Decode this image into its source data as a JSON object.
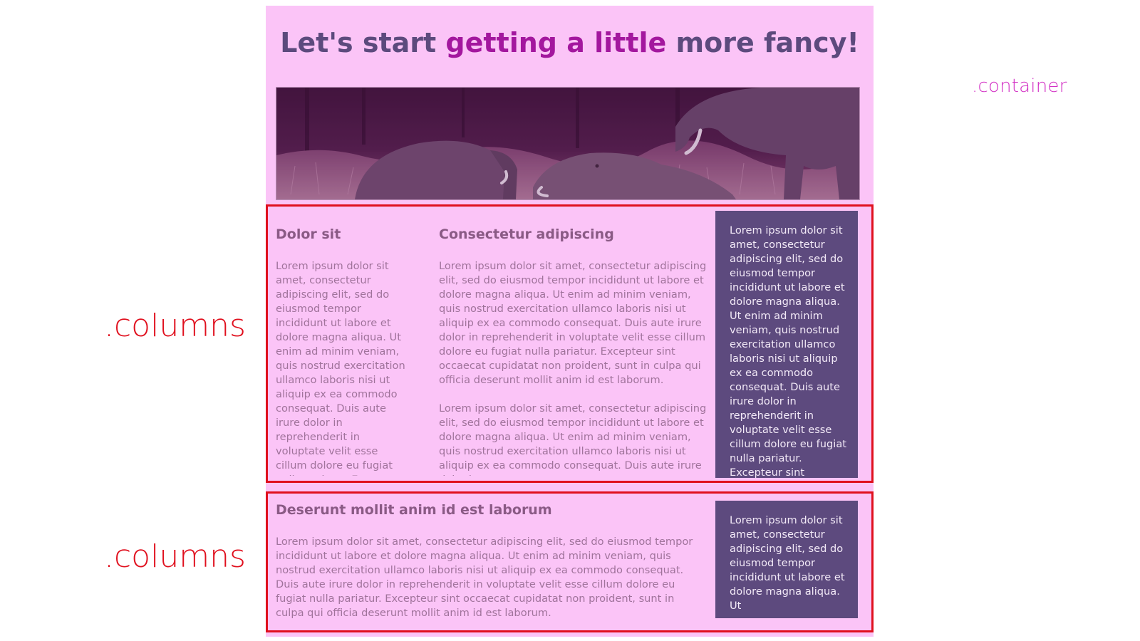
{
  "annotations": {
    "container": ".container",
    "columns_1": ".columns",
    "columns_2": ".columns"
  },
  "header": {
    "title_part1": "Let's start ",
    "title_accent": "getting a little",
    "title_part2": " more fancy!"
  },
  "hero_image": {
    "icon": "elephants-photo",
    "tint": "#6b2a63"
  },
  "row1": {
    "col1": {
      "heading": "Dolor sit",
      "text": "Lorem ipsum dolor sit amet, consectetur adipiscing elit, sed do eiusmod tempor incididunt ut labore et dolore magna aliqua. Ut enim ad minim veniam, quis nostrud exercitation ullamco laboris nisi ut aliquip ex ea commodo consequat. Duis aute irure dolor in reprehenderit in voluptate velit esse cillum dolore eu fugiat nulla pariatur. Excepteur sint occaecat"
    },
    "col2": {
      "heading": "Consectetur adipiscing",
      "para1": "Lorem ipsum dolor sit amet, consectetur adipiscing elit, sed do eiusmod tempor incididunt ut labore et dolore magna aliqua. Ut enim ad minim veniam, quis nostrud exercitation ullamco laboris nisi ut aliquip ex ea commodo consequat. Duis aute irure dolor in reprehenderit in voluptate velit esse cillum dolore eu fugiat nulla pariatur. Excepteur sint occaecat cupidatat non proident, sunt in culpa qui officia deserunt mollit anim id est laborum.",
      "para2": "Lorem ipsum dolor sit amet, consectetur adipiscing elit, sed do eiusmod tempor incididunt ut labore et dolore magna aliqua. Ut enim ad minim veniam, quis nostrud exercitation ullamco laboris nisi ut aliquip ex ea commodo consequat. Duis aute irure dolor in"
    },
    "aside": {
      "text": "Lorem ipsum dolor sit amet, consectetur adipiscing elit, sed do eiusmod tempor incididunt ut labore et dolore magna aliqua. Ut enim ad minim veniam, quis nostrud exercitation ullamco laboris nisi ut aliquip ex ea commodo consequat. Duis aute irure dolor in reprehenderit in voluptate velit esse cillum dolore eu fugiat nulla pariatur. Excepteur sint occaecat cupidatat"
    }
  },
  "row2": {
    "main": {
      "heading": "Deserunt mollit anim id est laborum",
      "text": "Lorem ipsum dolor sit amet, consectetur adipiscing elit, sed do eiusmod tempor incididunt ut labore et dolore magna aliqua. Ut enim ad minim veniam, quis nostrud exercitation ullamco laboris nisi ut aliquip ex ea commodo consequat. Duis aute irure dolor in reprehenderit in voluptate velit esse cillum dolore eu fugiat nulla pariatur. Excepteur sint occaecat cupidatat non proident, sunt in culpa qui officia deserunt mollit anim id est laborum."
    },
    "aside": {
      "text": "Lorem ipsum dolor sit amet, consectetur adipiscing elit, sed do eiusmod tempor incididunt ut labore et dolore magna aliqua. Ut"
    }
  },
  "colors": {
    "container_bg": "#fbc4f7",
    "title": "#5c4a7d",
    "title_accent": "#a3179e",
    "aside_bg": "#5d4a7e",
    "columns_outline": "#e0101e",
    "container_label": "#d22fc4"
  }
}
